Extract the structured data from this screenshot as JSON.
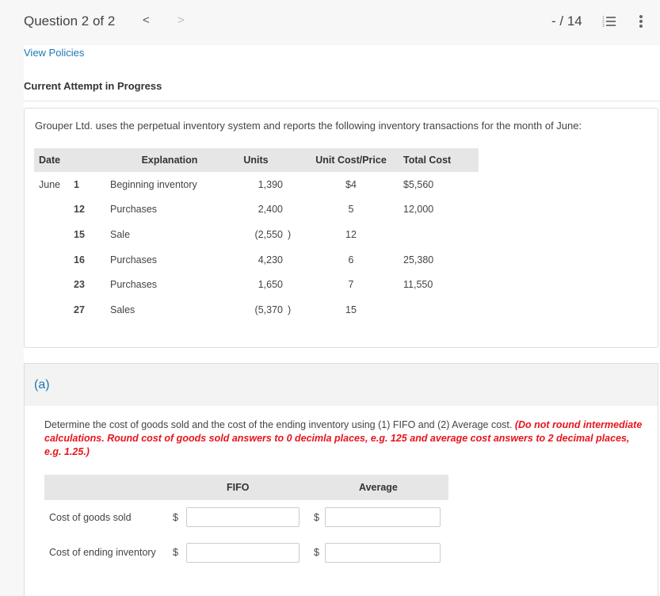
{
  "header": {
    "question_label": "Question 2 of 2",
    "prev_icon": "<",
    "next_icon": ">",
    "score": "- / 14"
  },
  "links": {
    "view_policies": "View Policies"
  },
  "status": {
    "attempt": "Current Attempt in Progress"
  },
  "problem": {
    "intro": "Grouper Ltd. uses the perpetual inventory system and reports the following inventory transactions for the month of June:",
    "table": {
      "headers": [
        "Date",
        "Explanation",
        "Units",
        "Unit Cost/Price",
        "Total Cost"
      ],
      "rows": [
        {
          "month": "June",
          "day": "1",
          "explanation": "Beginning inventory",
          "units": "1,390",
          "paren": "",
          "unit_cost": "$4",
          "total_cost": "$5,560"
        },
        {
          "month": "",
          "day": "12",
          "explanation": "Purchases",
          "units": "2,400",
          "paren": "",
          "unit_cost": "5",
          "total_cost": "12,000"
        },
        {
          "month": "",
          "day": "15",
          "explanation": "Sale",
          "units": "(2,550",
          "paren": ")",
          "unit_cost": "12",
          "total_cost": ""
        },
        {
          "month": "",
          "day": "16",
          "explanation": "Purchases",
          "units": "4,230",
          "paren": "",
          "unit_cost": "6",
          "total_cost": "25,380"
        },
        {
          "month": "",
          "day": "23",
          "explanation": "Purchases",
          "units": "1,650",
          "paren": "",
          "unit_cost": "7",
          "total_cost": "11,550"
        },
        {
          "month": "",
          "day": "27",
          "explanation": "Sales",
          "units": "(5,370",
          "paren": ")",
          "unit_cost": "15",
          "total_cost": ""
        }
      ]
    }
  },
  "part_a": {
    "label": "(a)",
    "instruction": "Determine the cost of goods sold and the cost of the ending inventory using (1) FIFO and (2) Average cost. ",
    "instruction_note": "(Do not round intermediate calculations. Round cost of goods sold answers to 0 decimla places, e.g. 125 and average cost answers to 2 decimal places, e.g. 1.25.)",
    "columns": [
      "FIFO",
      "Average"
    ],
    "rows": [
      {
        "label": "Cost of goods sold",
        "currency": "$",
        "fifo_value": "",
        "average_value": ""
      },
      {
        "label": "Cost of ending inventory",
        "currency": "$",
        "fifo_value": "",
        "average_value": ""
      }
    ]
  }
}
